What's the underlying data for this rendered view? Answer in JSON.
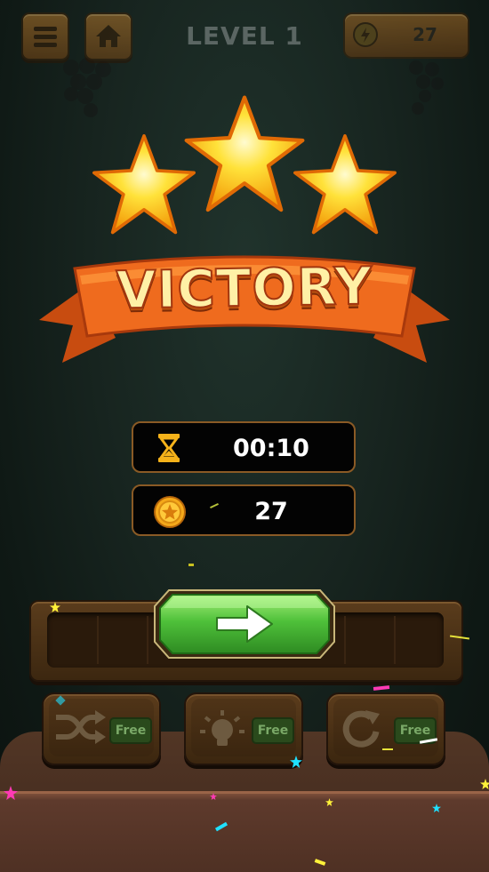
{
  "header": {
    "level_label": "LEVEL 1",
    "coin_count": "27",
    "menu_icon": "hamburger-menu-icon",
    "home_icon": "home-icon",
    "coin_icon": "coin-icon"
  },
  "result": {
    "stars_earned": 3,
    "stars_total": 3,
    "banner_text": "VICTORY"
  },
  "stats": {
    "time_value": "00:10",
    "time_icon": "hourglass-icon",
    "coins_value": "27",
    "coins_icon": "coin-icon"
  },
  "actions": {
    "next_icon": "arrow-right-icon",
    "powerups": [
      {
        "name": "shuffle",
        "icon": "shuffle-icon",
        "tag": "Free"
      },
      {
        "name": "hint",
        "icon": "lightbulb-icon",
        "tag": "Free"
      },
      {
        "name": "refresh",
        "icon": "refresh-icon",
        "tag": "Free"
      }
    ]
  },
  "colors": {
    "banner_orange": "#e8621a",
    "star_gold": "#ffd21f",
    "next_green": "#4fc13a",
    "stat_border": "#8a5a25"
  }
}
